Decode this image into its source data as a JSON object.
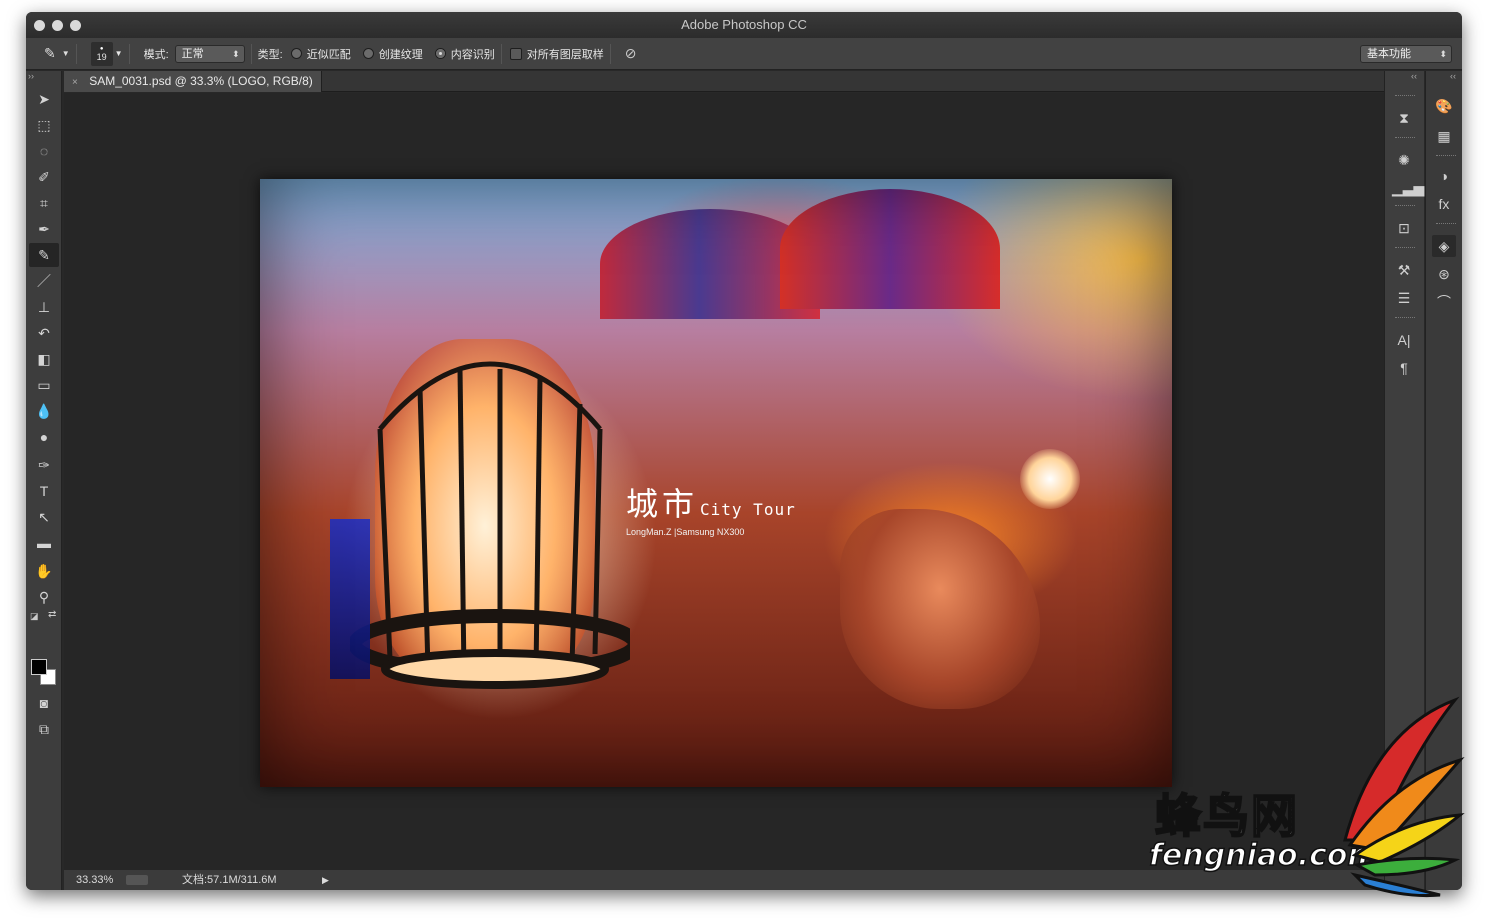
{
  "window": {
    "title": "Adobe Photoshop CC"
  },
  "options_bar": {
    "brush_size": "19",
    "mode_label": "模式:",
    "mode_value": "正常",
    "type_label": "类型:",
    "type_options": [
      "近似匹配",
      "创建纹理",
      "内容识别"
    ],
    "type_selected": "内容识别",
    "sample_all_layers_label": "对所有图层取样",
    "workspace_value": "基本功能"
  },
  "document": {
    "tab_title": "SAM_0031.psd @ 33.3% (LOGO, RGB/8)",
    "close_glyph": "×"
  },
  "photo_overlay": {
    "title_cn": "城市",
    "title_en": "City Tour",
    "credit": "LongMan.Z |Samsung NX300"
  },
  "status_bar": {
    "zoom": "33.33%",
    "doc_info": "文档:57.1M/311.6M",
    "arrow": "▶"
  },
  "watermark": {
    "brand_cn": "蜂鸟网",
    "brand_en": "fengniao.com"
  },
  "tools": [
    "move-tool",
    "marquee-tool",
    "lasso-tool",
    "quick-selection-tool",
    "crop-tool",
    "eyedropper-tool",
    "spot-healing-brush-tool",
    "brush-tool",
    "clone-stamp-tool",
    "history-brush-tool",
    "eraser-tool",
    "gradient-tool",
    "blur-tool",
    "dodge-tool",
    "pen-tool",
    "type-tool",
    "path-selection-tool",
    "rectangle-tool",
    "hand-tool",
    "zoom-tool"
  ],
  "colors": {
    "foreground": "#000000",
    "background": "#ffffff",
    "ui_dark": "#282828",
    "brand_red": "#d62a2a",
    "brand_orange": "#f08a1a",
    "brand_yellow": "#f5d418",
    "brand_green": "#3cae3c",
    "brand_blue": "#2a7fd4"
  }
}
